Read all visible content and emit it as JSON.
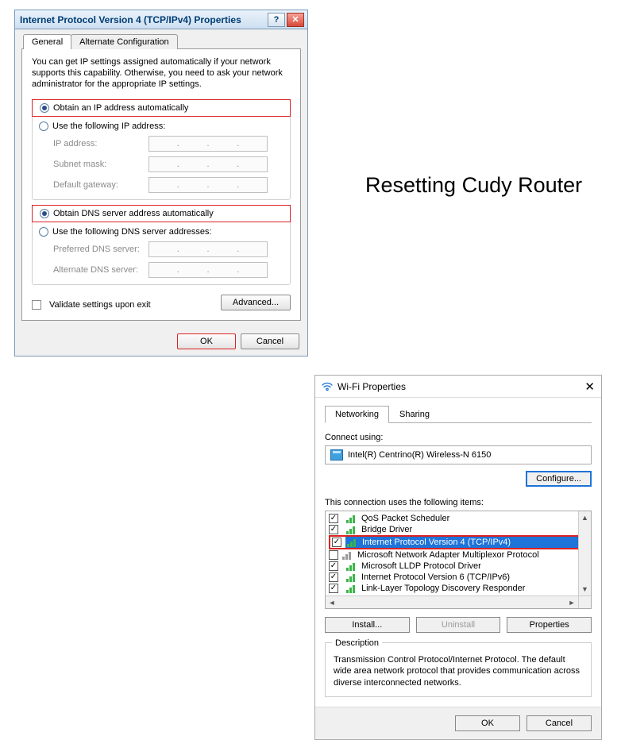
{
  "heading": "Resetting Cudy Router",
  "dlg1": {
    "title": "Internet Protocol Version 4 (TCP/IPv4) Properties",
    "tabs": {
      "general": "General",
      "alt": "Alternate Configuration"
    },
    "desc": "You can get IP settings assigned automatically if your network supports this capability. Otherwise, you need to ask your network administrator for the appropriate IP settings.",
    "ip": {
      "auto": "Obtain an IP address automatically",
      "manual": "Use the following IP address:",
      "f1": "IP address:",
      "f2": "Subnet mask:",
      "f3": "Default gateway:"
    },
    "dns": {
      "auto": "Obtain DNS server address automatically",
      "manual": "Use the following DNS server addresses:",
      "f1": "Preferred DNS server:",
      "f2": "Alternate DNS server:"
    },
    "validate": "Validate settings upon exit",
    "advanced": "Advanced...",
    "ok": "OK",
    "cancel": "Cancel"
  },
  "dlg2": {
    "title": "Wi-Fi Properties",
    "tabs": {
      "net": "Networking",
      "share": "Sharing"
    },
    "connect_using": "Connect using:",
    "adapter": "Intel(R) Centrino(R) Wireless-N 6150",
    "configure": "Configure...",
    "items_label": "This connection uses the following items:",
    "items": [
      {
        "label": "QoS Packet Scheduler",
        "checked": true,
        "grey": false
      },
      {
        "label": "Bridge Driver",
        "checked": true,
        "grey": false
      },
      {
        "label": "Internet Protocol Version 4 (TCP/IPv4)",
        "checked": true,
        "grey": false,
        "selected": true
      },
      {
        "label": "Microsoft Network Adapter Multiplexor Protocol",
        "checked": false,
        "grey": true
      },
      {
        "label": "Microsoft LLDP Protocol Driver",
        "checked": true,
        "grey": false
      },
      {
        "label": "Internet Protocol Version 6 (TCP/IPv6)",
        "checked": true,
        "grey": false
      },
      {
        "label": "Link-Layer Topology Discovery Responder",
        "checked": true,
        "grey": false
      }
    ],
    "install": "Install...",
    "uninstall": "Uninstall",
    "properties": "Properties",
    "desc_heading": "Description",
    "desc_text": "Transmission Control Protocol/Internet Protocol. The default wide area network protocol that provides communication across diverse interconnected networks.",
    "ok": "OK",
    "cancel": "Cancel"
  }
}
